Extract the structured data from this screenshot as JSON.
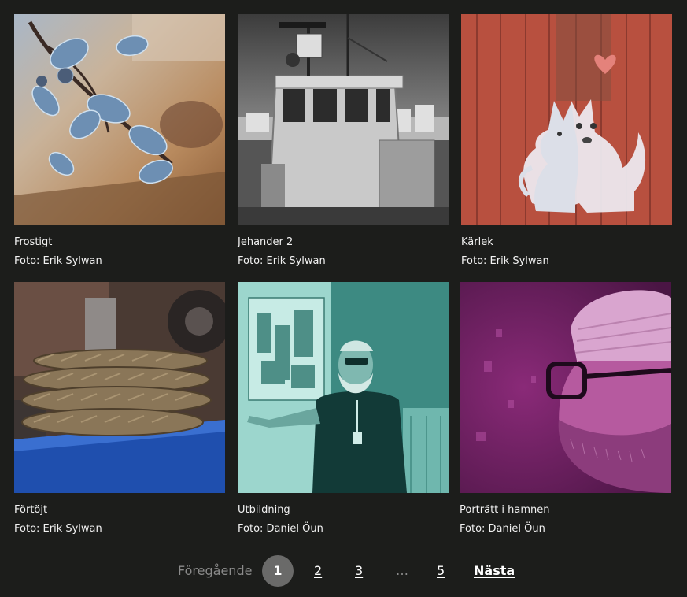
{
  "gallery": {
    "items": [
      {
        "title": "Frostigt",
        "credit": "Foto: Erik Sylwan",
        "image": "frosted-leaves-photo"
      },
      {
        "title": "Jehander 2",
        "credit": "Foto: Erik Sylwan",
        "image": "boat-wheelhouse-photo"
      },
      {
        "title": "Kärlek",
        "credit": "Foto: Erik Sylwan",
        "image": "dogs-on-red-wall-photo"
      },
      {
        "title": "Förtöjt",
        "credit": "Foto: Erik Sylwan",
        "image": "mooring-rope-photo"
      },
      {
        "title": "Utbildning",
        "credit": "Foto: Daniel Öun",
        "image": "presenter-teal-photo"
      },
      {
        "title": "Porträtt i hamnen",
        "credit": "Foto: Daniel Öun",
        "image": "bearded-man-portrait-photo"
      }
    ]
  },
  "pagination": {
    "previous": "Föregående",
    "pages": [
      "1",
      "2",
      "3",
      "…",
      "5"
    ],
    "current": "1",
    "next": "Nästa"
  },
  "colors": {
    "background": "#1c1d1b",
    "text": "#ffffff",
    "muted": "#8b8b8b",
    "current_page_bg": "#6a6a69"
  }
}
